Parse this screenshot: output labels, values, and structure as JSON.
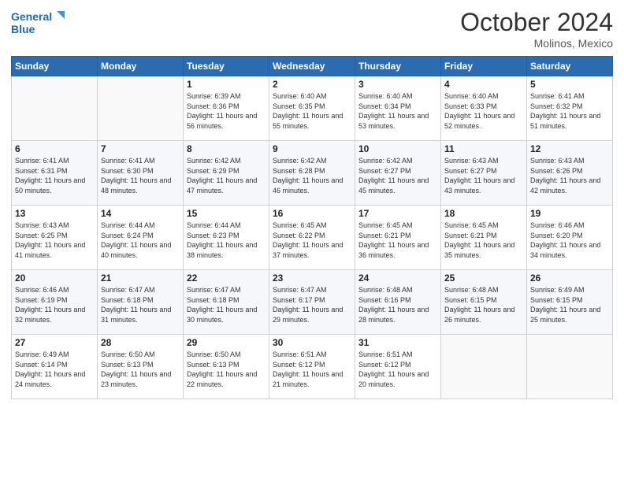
{
  "header": {
    "logo_line1": "General",
    "logo_line2": "Blue",
    "month": "October 2024",
    "location": "Molinos, Mexico"
  },
  "days_of_week": [
    "Sunday",
    "Monday",
    "Tuesday",
    "Wednesday",
    "Thursday",
    "Friday",
    "Saturday"
  ],
  "weeks": [
    [
      {
        "day": "",
        "info": ""
      },
      {
        "day": "",
        "info": ""
      },
      {
        "day": "1",
        "info": "Sunrise: 6:39 AM\nSunset: 6:36 PM\nDaylight: 11 hours and 56 minutes."
      },
      {
        "day": "2",
        "info": "Sunrise: 6:40 AM\nSunset: 6:35 PM\nDaylight: 11 hours and 55 minutes."
      },
      {
        "day": "3",
        "info": "Sunrise: 6:40 AM\nSunset: 6:34 PM\nDaylight: 11 hours and 53 minutes."
      },
      {
        "day": "4",
        "info": "Sunrise: 6:40 AM\nSunset: 6:33 PM\nDaylight: 11 hours and 52 minutes."
      },
      {
        "day": "5",
        "info": "Sunrise: 6:41 AM\nSunset: 6:32 PM\nDaylight: 11 hours and 51 minutes."
      }
    ],
    [
      {
        "day": "6",
        "info": "Sunrise: 6:41 AM\nSunset: 6:31 PM\nDaylight: 11 hours and 50 minutes."
      },
      {
        "day": "7",
        "info": "Sunrise: 6:41 AM\nSunset: 6:30 PM\nDaylight: 11 hours and 48 minutes."
      },
      {
        "day": "8",
        "info": "Sunrise: 6:42 AM\nSunset: 6:29 PM\nDaylight: 11 hours and 47 minutes."
      },
      {
        "day": "9",
        "info": "Sunrise: 6:42 AM\nSunset: 6:28 PM\nDaylight: 11 hours and 46 minutes."
      },
      {
        "day": "10",
        "info": "Sunrise: 6:42 AM\nSunset: 6:27 PM\nDaylight: 11 hours and 45 minutes."
      },
      {
        "day": "11",
        "info": "Sunrise: 6:43 AM\nSunset: 6:27 PM\nDaylight: 11 hours and 43 minutes."
      },
      {
        "day": "12",
        "info": "Sunrise: 6:43 AM\nSunset: 6:26 PM\nDaylight: 11 hours and 42 minutes."
      }
    ],
    [
      {
        "day": "13",
        "info": "Sunrise: 6:43 AM\nSunset: 6:25 PM\nDaylight: 11 hours and 41 minutes."
      },
      {
        "day": "14",
        "info": "Sunrise: 6:44 AM\nSunset: 6:24 PM\nDaylight: 11 hours and 40 minutes."
      },
      {
        "day": "15",
        "info": "Sunrise: 6:44 AM\nSunset: 6:23 PM\nDaylight: 11 hours and 38 minutes."
      },
      {
        "day": "16",
        "info": "Sunrise: 6:45 AM\nSunset: 6:22 PM\nDaylight: 11 hours and 37 minutes."
      },
      {
        "day": "17",
        "info": "Sunrise: 6:45 AM\nSunset: 6:21 PM\nDaylight: 11 hours and 36 minutes."
      },
      {
        "day": "18",
        "info": "Sunrise: 6:45 AM\nSunset: 6:21 PM\nDaylight: 11 hours and 35 minutes."
      },
      {
        "day": "19",
        "info": "Sunrise: 6:46 AM\nSunset: 6:20 PM\nDaylight: 11 hours and 34 minutes."
      }
    ],
    [
      {
        "day": "20",
        "info": "Sunrise: 6:46 AM\nSunset: 6:19 PM\nDaylight: 11 hours and 32 minutes."
      },
      {
        "day": "21",
        "info": "Sunrise: 6:47 AM\nSunset: 6:18 PM\nDaylight: 11 hours and 31 minutes."
      },
      {
        "day": "22",
        "info": "Sunrise: 6:47 AM\nSunset: 6:18 PM\nDaylight: 11 hours and 30 minutes."
      },
      {
        "day": "23",
        "info": "Sunrise: 6:47 AM\nSunset: 6:17 PM\nDaylight: 11 hours and 29 minutes."
      },
      {
        "day": "24",
        "info": "Sunrise: 6:48 AM\nSunset: 6:16 PM\nDaylight: 11 hours and 28 minutes."
      },
      {
        "day": "25",
        "info": "Sunrise: 6:48 AM\nSunset: 6:15 PM\nDaylight: 11 hours and 26 minutes."
      },
      {
        "day": "26",
        "info": "Sunrise: 6:49 AM\nSunset: 6:15 PM\nDaylight: 11 hours and 25 minutes."
      }
    ],
    [
      {
        "day": "27",
        "info": "Sunrise: 6:49 AM\nSunset: 6:14 PM\nDaylight: 11 hours and 24 minutes."
      },
      {
        "day": "28",
        "info": "Sunrise: 6:50 AM\nSunset: 6:13 PM\nDaylight: 11 hours and 23 minutes."
      },
      {
        "day": "29",
        "info": "Sunrise: 6:50 AM\nSunset: 6:13 PM\nDaylight: 11 hours and 22 minutes."
      },
      {
        "day": "30",
        "info": "Sunrise: 6:51 AM\nSunset: 6:12 PM\nDaylight: 11 hours and 21 minutes."
      },
      {
        "day": "31",
        "info": "Sunrise: 6:51 AM\nSunset: 6:12 PM\nDaylight: 11 hours and 20 minutes."
      },
      {
        "day": "",
        "info": ""
      },
      {
        "day": "",
        "info": ""
      }
    ]
  ]
}
